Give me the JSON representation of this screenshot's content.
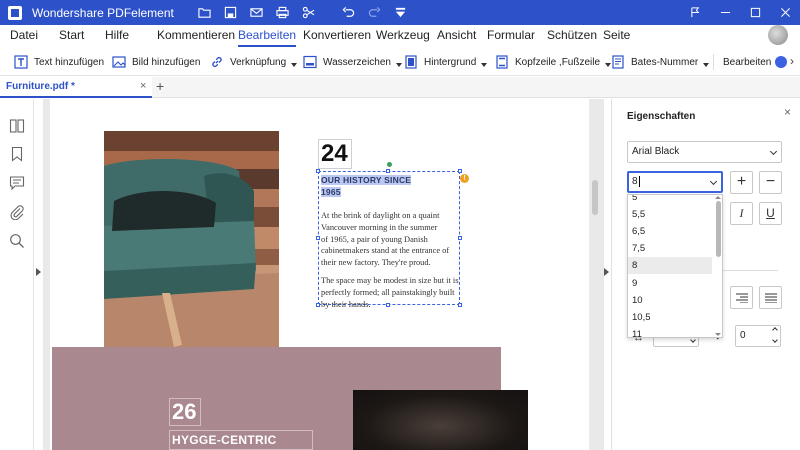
{
  "app": {
    "title": "Wondershare PDFelement"
  },
  "menu": [
    {
      "label": "Datei"
    },
    {
      "label": "Start"
    },
    {
      "label": "Hilfe"
    },
    {
      "label": "Kommentieren"
    },
    {
      "label": "Bearbeiten",
      "active": true
    },
    {
      "label": "Konvertieren"
    },
    {
      "label": "Werkzeug"
    },
    {
      "label": "Ansicht"
    },
    {
      "label": "Formular"
    },
    {
      "label": "Schützen"
    },
    {
      "label": "Seite"
    }
  ],
  "toolbar": {
    "add_text": "Text hinzufügen",
    "add_image": "Bild hinzufügen",
    "link": "Verknüpfung",
    "watermark": "Wasserzeichen",
    "background": "Hintergrund",
    "header_footer": "Kopfzeile ,Fußzeile",
    "bates": "Bates-Nummer",
    "edit": "Bearbeiten"
  },
  "tab": {
    "label": "Furniture.pdf *",
    "close": "×",
    "add": "+"
  },
  "document": {
    "number_1": "24",
    "history_line1": "OUR HISTORY SINCE",
    "history_line2": "1965",
    "para_lines": [
      "At the brink of daylight on a quaint",
      "Vancouver morning in the summer",
      "of 1965, a pair of young Danish",
      "cabinetmakers stand at the entrance of",
      "their new factory. They're proud.",
      "",
      "The space may be modest in size but it is",
      "perfectly formed; all painstakingly built",
      "by their hands."
    ],
    "number_2": "26",
    "heading_2": "HYGGE-CENTRIC",
    "warning_glyph": "!"
  },
  "panel": {
    "title": "Eigenschaften",
    "close": "×",
    "font": "Arial Black",
    "font_size": "8",
    "increase": "+",
    "decrease": "−",
    "italic": "I",
    "underline": "U",
    "size_options": [
      "5",
      "5,5",
      "6,5",
      "7,5",
      "8",
      "9",
      "10",
      "10,5",
      "11"
    ],
    "highlighted_option": "8",
    "char_spacing": "0",
    "line_spacing": "0"
  },
  "colors": {
    "accent": "#2c51c9",
    "highlight": "#bdc8f2",
    "pink_block": "#a98890"
  }
}
